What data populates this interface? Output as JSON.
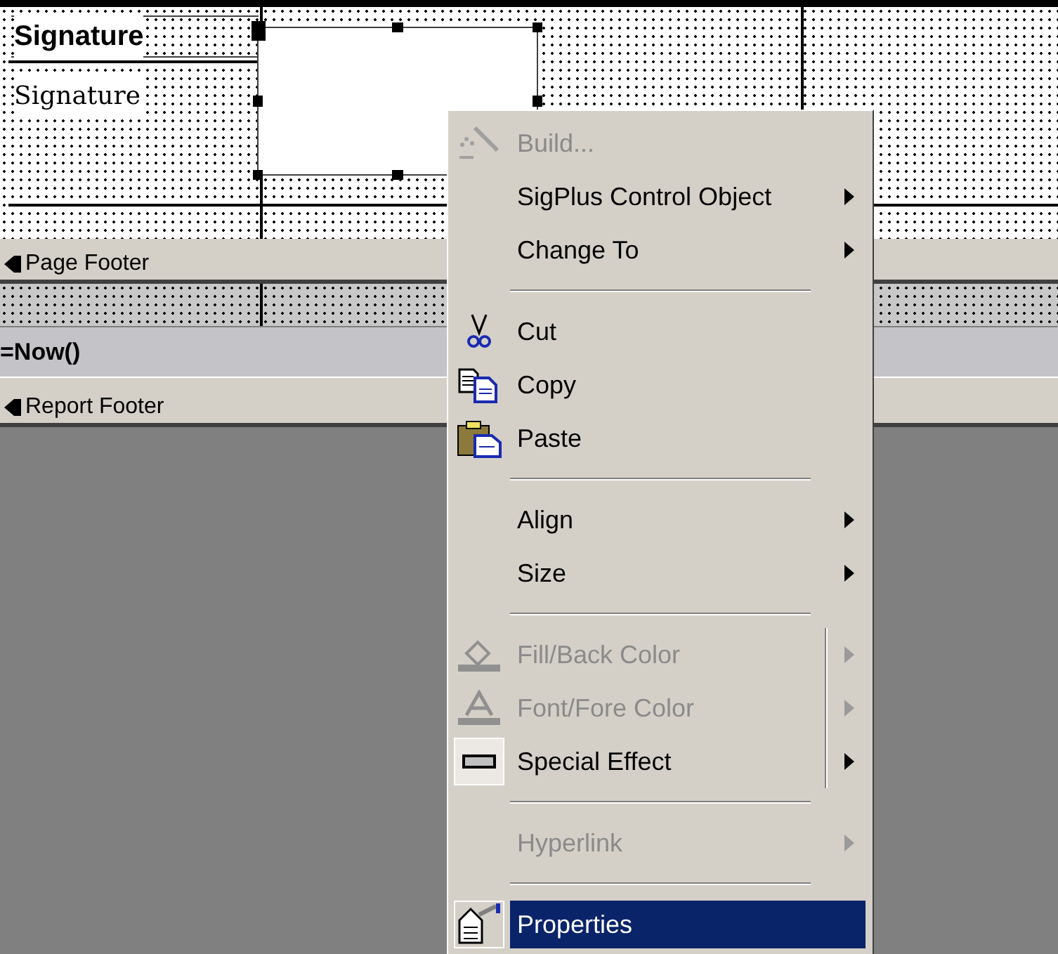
{
  "designer": {
    "detail_section": {
      "label_text": "Signature",
      "field_text": "Signature"
    },
    "page_footer": {
      "title": "Page Footer",
      "expression": "=Now()"
    },
    "report_footer": {
      "title": "Report Footer"
    }
  },
  "context_menu": {
    "items": [
      {
        "kind": "item",
        "label": "Build...",
        "disabled": true,
        "submenu": false,
        "split": false,
        "selected": false
      },
      {
        "kind": "item",
        "label": "SigPlus Control Object",
        "disabled": false,
        "submenu": true,
        "split": false,
        "selected": false
      },
      {
        "kind": "item",
        "label": "Change To",
        "disabled": false,
        "submenu": true,
        "split": false,
        "selected": false
      },
      {
        "kind": "separator"
      },
      {
        "kind": "item",
        "label": "Cut",
        "disabled": false,
        "submenu": false,
        "split": false,
        "selected": false
      },
      {
        "kind": "item",
        "label": "Copy",
        "disabled": false,
        "submenu": false,
        "split": false,
        "selected": false
      },
      {
        "kind": "item",
        "label": "Paste",
        "disabled": false,
        "submenu": false,
        "split": false,
        "selected": false
      },
      {
        "kind": "separator"
      },
      {
        "kind": "item",
        "label": "Align",
        "disabled": false,
        "submenu": true,
        "split": false,
        "selected": false
      },
      {
        "kind": "item",
        "label": "Size",
        "disabled": false,
        "submenu": true,
        "split": false,
        "selected": false
      },
      {
        "kind": "separator"
      },
      {
        "kind": "item",
        "label": "Fill/Back Color",
        "disabled": true,
        "submenu": true,
        "split": true,
        "selected": false
      },
      {
        "kind": "item",
        "label": "Font/Fore Color",
        "disabled": true,
        "submenu": true,
        "split": true,
        "selected": false
      },
      {
        "kind": "item",
        "label": "Special Effect",
        "disabled": false,
        "submenu": true,
        "split": true,
        "selected": false
      },
      {
        "kind": "separator"
      },
      {
        "kind": "item",
        "label": "Hyperlink",
        "disabled": true,
        "submenu": true,
        "split": false,
        "selected": false
      },
      {
        "kind": "separator"
      },
      {
        "kind": "item",
        "label": "Properties",
        "disabled": false,
        "submenu": false,
        "split": false,
        "selected": true
      }
    ]
  }
}
